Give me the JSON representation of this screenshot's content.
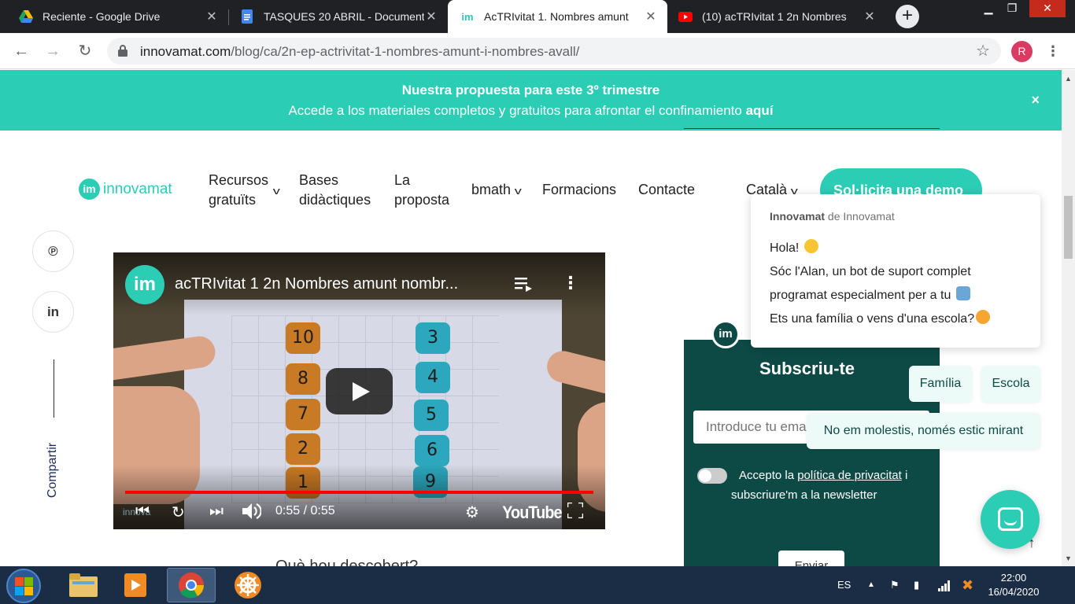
{
  "browser": {
    "tabs": [
      {
        "title": "Reciente - Google Drive",
        "icon": "google-drive-icon",
        "active": false
      },
      {
        "title": "TASQUES 20 ABRIL - Document",
        "icon": "google-docs-icon",
        "active": false
      },
      {
        "title": "AcTRIvitat 1. Nombres amunt",
        "icon": "innovamat-favicon",
        "active": true
      },
      {
        "title": "(10) acTRIvitat 1 2n Nombres",
        "icon": "youtube-icon",
        "active": false
      }
    ],
    "new_tab_label": "+",
    "url_domain": "innovamat.com",
    "url_path": "/blog/ca/2n-ep-actrivitat-1-nombres-amunt-i-nombres-avall/",
    "profile_initial": "R",
    "window_buttons": {
      "minimize": "▁",
      "maximize": "❐",
      "close": "✕"
    }
  },
  "banner": {
    "line1": "Nuestra propuesta para este 3º trimestre",
    "line2_text": "Accede a los materiales completos y gratuitos para afrontar el confinamiento",
    "line2_link": "aquí",
    "close": "×"
  },
  "header": {
    "logo_mark": "im",
    "logo_text": "innovamat",
    "nav": [
      {
        "label_line1": "Recursos",
        "label_line2": "gratuïts",
        "has_dropdown": true
      },
      {
        "label_line1": "Bases",
        "label_line2": "didàctiques",
        "has_dropdown": false
      },
      {
        "label_line1": "La",
        "label_line2": "proposta",
        "has_dropdown": false
      },
      {
        "label_line1": "bmath",
        "label_line2": "",
        "has_dropdown": true
      },
      {
        "label_line1": "Formacions",
        "label_line2": "",
        "has_dropdown": false
      },
      {
        "label_line1": "Contacte",
        "label_line2": "",
        "has_dropdown": false
      }
    ],
    "language": "Català",
    "demo_button": "Sol·licita una demo"
  },
  "share": {
    "buttons": [
      {
        "icon": "pinterest-icon",
        "glyph": "℗"
      },
      {
        "icon": "linkedin-icon",
        "glyph": "in"
      }
    ],
    "label": "Compartir"
  },
  "video": {
    "channel_mark": "im",
    "title": "acTRIvitat 1 2n Nombres amunt nombr...",
    "orange_cards": [
      "10",
      "8",
      "7",
      "2",
      "1"
    ],
    "blue_cards": [
      "3",
      "4",
      "5",
      "6",
      "9"
    ],
    "progress": 1.0,
    "time": "0:55 / 0:55",
    "brand": "YouTube",
    "watermark": "innova"
  },
  "article": {
    "partial_heading": "Què hou descobert?"
  },
  "subscribe": {
    "title": "Subscriu-te",
    "email_placeholder": "Introduce tu email",
    "consent_prefix": "Accepto la",
    "consent_link": "política de privacitat",
    "consent_suffix_1": " i",
    "consent_suffix_2": "subscriure'm a la newsletter",
    "submit": "Enviar"
  },
  "chat": {
    "sender_name": "Innovamat",
    "sender_suffix": "de Innovamat",
    "line1": "Hola!",
    "line2": "Sóc l'Alan, un bot de suport complet",
    "line3": "programat especialment per a tu",
    "line4": "Ets una família o vens d'una escola?",
    "avatar_mark": "im",
    "quick_replies": [
      "Família",
      "Escola",
      "No em molestis, només estic mirant"
    ]
  },
  "taskbar": {
    "language": "ES",
    "time": "22:00",
    "date": "16/04/2020"
  },
  "colors": {
    "brand_teal": "#2ccdb5",
    "dark_teal": "#0d4a45",
    "taskbar": "#1b2d45",
    "youtube_red": "#ff0000"
  }
}
